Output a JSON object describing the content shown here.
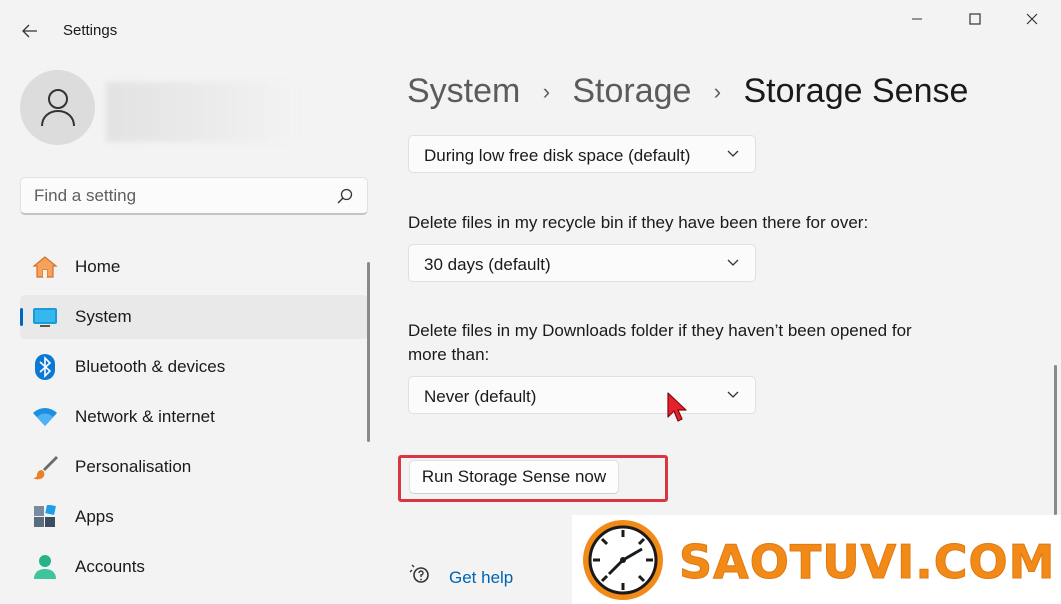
{
  "app": {
    "title": "Settings"
  },
  "window": {
    "minimize": "minimize",
    "maximize": "maximize",
    "close": "close"
  },
  "search": {
    "placeholder": "Find a setting"
  },
  "sidebar": {
    "items": [
      {
        "label": "Home",
        "icon": "home-icon"
      },
      {
        "label": "System",
        "icon": "system-icon",
        "selected": true
      },
      {
        "label": "Bluetooth & devices",
        "icon": "bluetooth-icon"
      },
      {
        "label": "Network & internet",
        "icon": "wifi-icon"
      },
      {
        "label": "Personalisation",
        "icon": "brush-icon"
      },
      {
        "label": "Apps",
        "icon": "apps-icon"
      },
      {
        "label": "Accounts",
        "icon": "accounts-icon"
      }
    ]
  },
  "breadcrumb": {
    "level1": "System",
    "level2": "Storage",
    "current": "Storage Sense",
    "separator": "›"
  },
  "settings": {
    "run_frequency": {
      "value": "During low free disk space (default)"
    },
    "recycle_bin": {
      "label": "Delete files in my recycle bin if they have been there for over:",
      "value": "30 days (default)"
    },
    "downloads": {
      "label": "Delete files in my Downloads folder if they haven’t been opened for more than:",
      "value": "Never (default)"
    },
    "run_now_label": "Run Storage Sense now"
  },
  "help": {
    "label": "Get help"
  },
  "watermark": {
    "text": "SAOTUVI.COM"
  },
  "colors": {
    "accent": "#0067c0",
    "highlight": "#d9373f",
    "watermark": "#f28a18",
    "link": "#0063b1"
  }
}
